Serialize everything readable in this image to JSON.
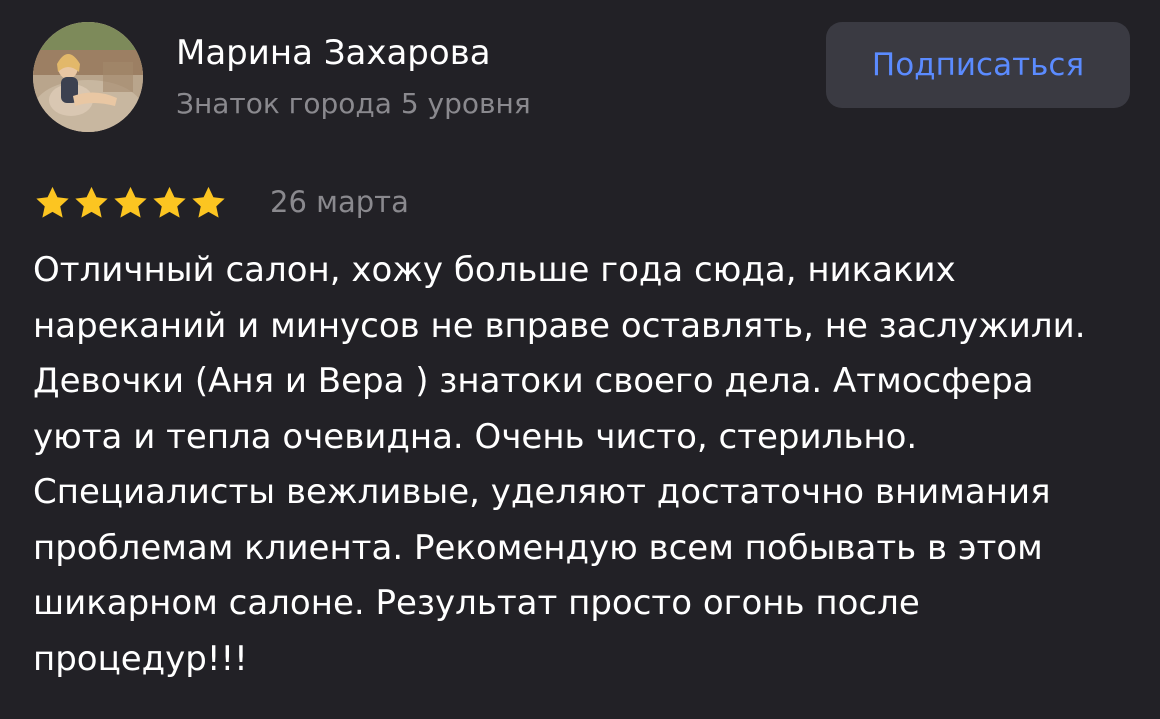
{
  "author": {
    "name": "Марина Захарова",
    "level": "Знаток города 5 уровня"
  },
  "subscribe": {
    "label": "Подписаться",
    "color": "#5b8bff"
  },
  "review": {
    "rating": 5,
    "max_rating": 5,
    "star_color": "#fcc521",
    "date": "26 марта",
    "text": "Отличный салон, хожу больше года сюда, никаких нареканий и минусов не вправе оставлять, не заслужили. Девочки (Аня и Вера ) знатоки своего дела. Атмосфера уюта и тепла очевидна. Очень чисто, стерильно. Специалисты вежливые, уделяют достаточно внимания проблемам клиента. Рекомендую всем побывать в этом шикарном салоне. Результат просто огонь после процедур!!!"
  },
  "icons": {
    "avatar": "user-photo",
    "star": "star-icon"
  },
  "colors": {
    "background": "#222126",
    "secondary_text": "#8a898e",
    "button_background": "#3a3a42"
  }
}
